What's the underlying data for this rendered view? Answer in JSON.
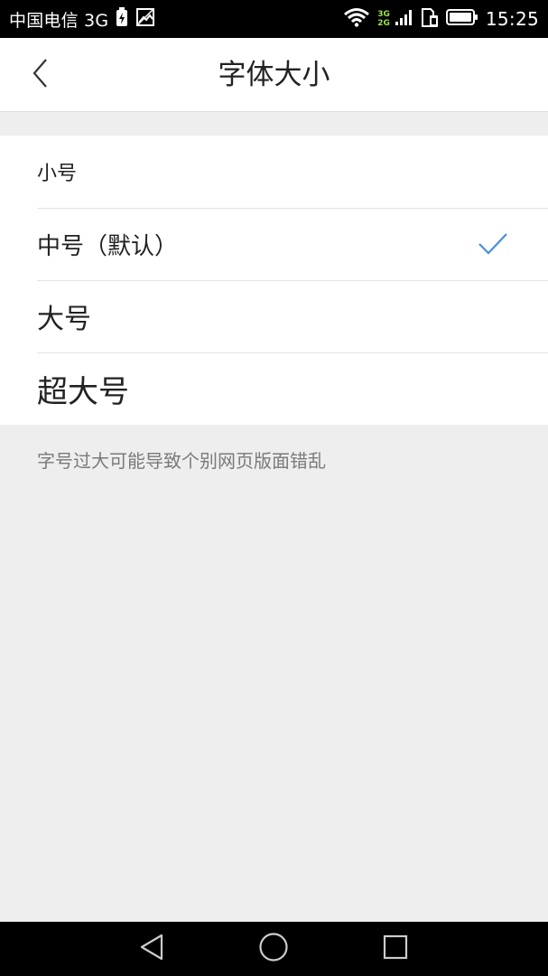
{
  "status_bar": {
    "carrier": "中国电信 3G",
    "sim_label_1": "3G",
    "sim_label_2": "2G",
    "time": "15:25",
    "icons": [
      "battery-saver-icon",
      "image-icon",
      "wifi-icon",
      "signal-icon",
      "sim-icon",
      "battery-icon"
    ]
  },
  "header": {
    "title": "字体大小",
    "back_icon": "chevron-left-icon"
  },
  "options": [
    {
      "label": "小号",
      "selected": false
    },
    {
      "label": "中号（默认）",
      "selected": true
    },
    {
      "label": "大号",
      "selected": false
    },
    {
      "label": "超大号",
      "selected": false
    }
  ],
  "hint": "字号过大可能导致个别网页版面错乱",
  "colors": {
    "check": "#4a90d9",
    "background": "#eeeeee"
  },
  "nav_bar": {
    "icons": [
      "back-triangle-icon",
      "home-circle-icon",
      "recent-square-icon"
    ]
  }
}
